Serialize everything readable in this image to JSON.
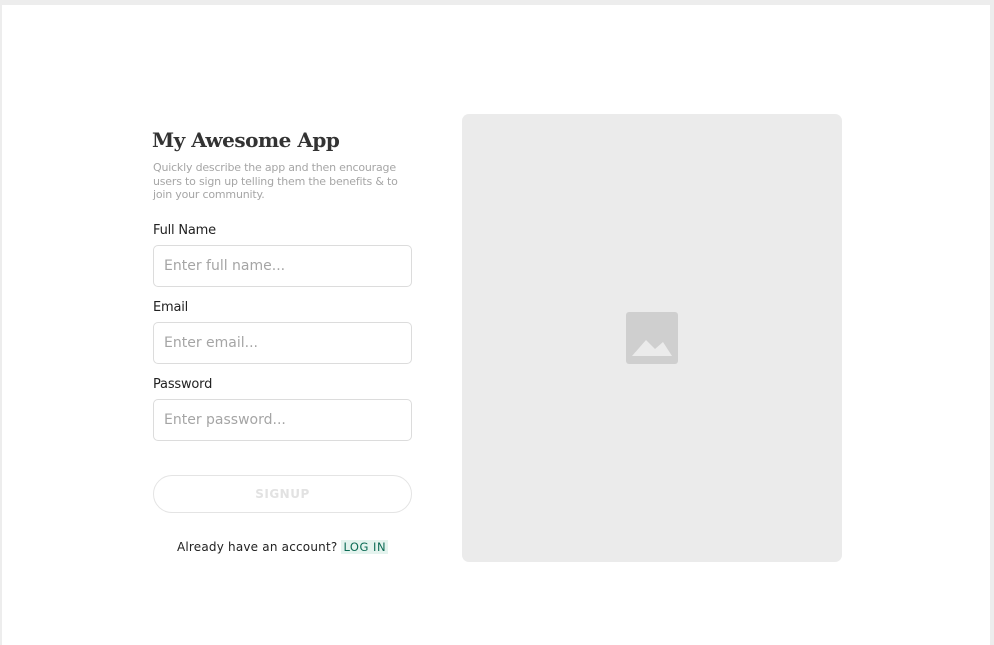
{
  "app": {
    "title": "My Awesome App",
    "description": "Quickly describe the app and then encourage users to sign up telling them the benefits & to join your community."
  },
  "form": {
    "full_name": {
      "label": "Full Name",
      "placeholder": "Enter full name..."
    },
    "email": {
      "label": "Email",
      "placeholder": "Enter email..."
    },
    "password": {
      "label": "Password",
      "placeholder": "Enter password..."
    },
    "signup_label": "SIGNUP",
    "login_prompt": "Already have an account?",
    "login_link": "LOG IN"
  },
  "image_panel": {
    "icon": "image-placeholder-icon"
  },
  "colors": {
    "panel_bg": "#ebebeb",
    "icon_fill": "#cfcfcf",
    "link_bg": "#e4f3ee",
    "link_text": "#0d6b55"
  }
}
